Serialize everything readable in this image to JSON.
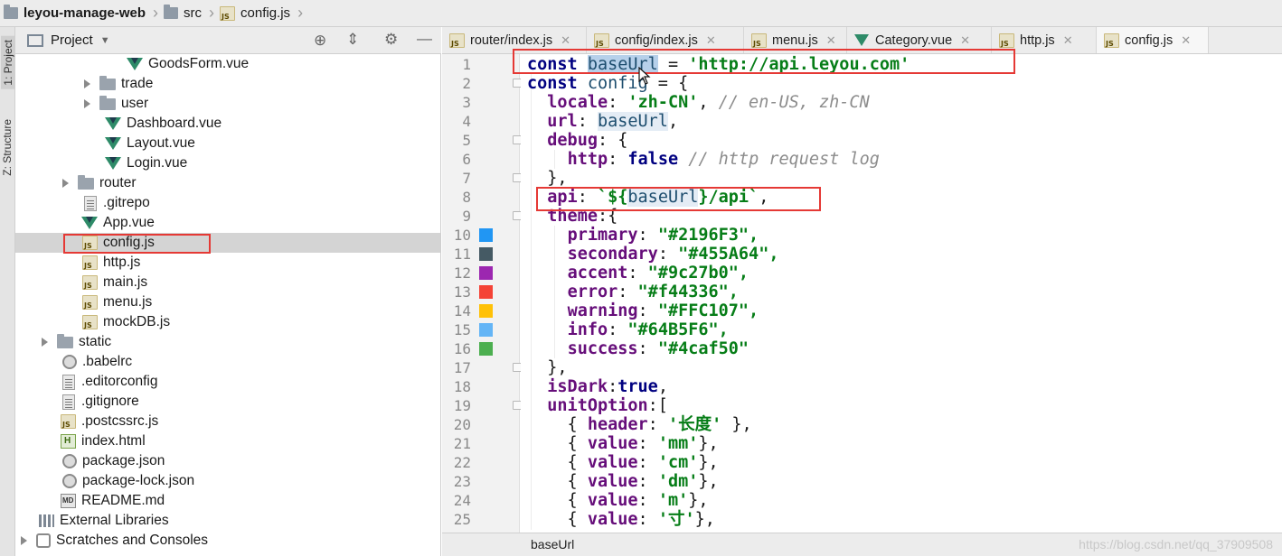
{
  "nav": {
    "project": "leyou-manage-web",
    "folder": "src",
    "file": "config.js"
  },
  "side_tabs": {
    "project": "1: Project",
    "structure": "Z: Structure"
  },
  "project_panel": {
    "title": "Project",
    "tree": [
      {
        "label": "GoodsForm.vue",
        "icon": "vue-file-icon",
        "level": 5
      },
      {
        "label": "trade",
        "icon": "folder-icon",
        "level": 4,
        "expandable": true
      },
      {
        "label": "user",
        "icon": "folder-icon",
        "level": 4,
        "expandable": true
      },
      {
        "label": "Dashboard.vue",
        "icon": "vue-file-icon",
        "level": 4
      },
      {
        "label": "Layout.vue",
        "icon": "vue-file-icon",
        "level": 4
      },
      {
        "label": "Login.vue",
        "icon": "vue-file-icon",
        "level": 4
      },
      {
        "label": "router",
        "icon": "folder-icon",
        "level": 3,
        "expandable": true
      },
      {
        "label": ".gitrepo",
        "icon": "text-file-icon",
        "level": 3
      },
      {
        "label": "App.vue",
        "icon": "vue-file-icon",
        "level": 3
      },
      {
        "label": "config.js",
        "icon": "js-file-icon",
        "level": 3,
        "selected": true
      },
      {
        "label": "http.js",
        "icon": "js-file-icon",
        "level": 3
      },
      {
        "label": "main.js",
        "icon": "js-file-icon",
        "level": 3
      },
      {
        "label": "menu.js",
        "icon": "js-file-icon",
        "level": 3
      },
      {
        "label": "mockDB.js",
        "icon": "js-file-icon",
        "level": 3
      },
      {
        "label": "static",
        "icon": "folder-icon",
        "level": 2,
        "expandable": true
      },
      {
        "label": ".babelrc",
        "icon": "config-file-icon",
        "level": 2
      },
      {
        "label": ".editorconfig",
        "icon": "text-file-icon",
        "level": 2
      },
      {
        "label": ".gitignore",
        "icon": "text-file-icon",
        "level": 2
      },
      {
        "label": ".postcssrc.js",
        "icon": "js-file-icon",
        "level": 2
      },
      {
        "label": "index.html",
        "icon": "html-file-icon",
        "level": 2
      },
      {
        "label": "package.json",
        "icon": "config-file-icon",
        "level": 2
      },
      {
        "label": "package-lock.json",
        "icon": "config-file-icon",
        "level": 2
      },
      {
        "label": "README.md",
        "icon": "markdown-file-icon",
        "level": 2
      },
      {
        "label": "External Libraries",
        "icon": "libraries-icon",
        "level": 1
      },
      {
        "label": "Scratches and Consoles",
        "icon": "scratches-icon",
        "level": 1,
        "expandable": true
      }
    ]
  },
  "editor_tabs": [
    {
      "label": "router/index.js",
      "icon": "js-file-icon"
    },
    {
      "label": "config/index.js",
      "icon": "js-file-icon"
    },
    {
      "label": "menu.js",
      "icon": "js-file-icon"
    },
    {
      "label": "Category.vue",
      "icon": "vue-file-icon"
    },
    {
      "label": "http.js",
      "icon": "js-file-icon"
    },
    {
      "label": "config.js",
      "icon": "js-file-icon",
      "active": true
    }
  ],
  "code_lines": [
    "1",
    "2",
    "3",
    "4",
    "5",
    "6",
    "7",
    "8",
    "9",
    "10",
    "11",
    "12",
    "13",
    "14",
    "15",
    "16",
    "17",
    "18",
    "19",
    "20",
    "21",
    "22",
    "23",
    "24",
    "25"
  ],
  "color_swatches": [
    "#2196F3",
    "#455A64",
    "#9c27b0",
    "#f44336",
    "#FFC107",
    "#64B5F6",
    "#4caf50"
  ],
  "code": {
    "l1": {
      "k": "const",
      "v": "baseUrl",
      "eq": " = ",
      "s": "'http://api.leyou.com'"
    },
    "l2": {
      "k": "const",
      "v": "config",
      "rest": " = {"
    },
    "l3": {
      "p": "locale",
      "s": "'zh-CN'",
      "c": "// en-US, zh-CN"
    },
    "l4": {
      "p": "url",
      "v": "baseUrl"
    },
    "l5": {
      "p": "debug"
    },
    "l6": {
      "p": "http",
      "k": "false",
      "c": "// http request log"
    },
    "l8": {
      "p": "api",
      "a": "`${",
      "v": "baseUrl",
      "b": "}/api`"
    },
    "l9": {
      "p": "theme"
    },
    "theme": [
      {
        "p": "primary",
        "s": "\"#2196F3\","
      },
      {
        "p": "secondary",
        "s": "\"#455A64\","
      },
      {
        "p": "accent",
        "s": "\"#9c27b0\","
      },
      {
        "p": "error",
        "s": "\"#f44336\","
      },
      {
        "p": "warning",
        "s": "\"#FFC107\","
      },
      {
        "p": "info",
        "s": "\"#64B5F6\","
      },
      {
        "p": "success",
        "s": "\"#4caf50\""
      }
    ],
    "l18": {
      "p": "isDark",
      "k": "true"
    },
    "l19": {
      "p": "unitOption"
    },
    "l20": {
      "p": "header",
      "s": "'长度'"
    },
    "units": [
      "'mm'",
      "'cm'",
      "'dm'",
      "'m'",
      "'寸'"
    ],
    "value_key": "value"
  },
  "status_bar": {
    "breadcrumb": "baseUrl",
    "watermark": "https://blog.csdn.net/qq_37909508"
  }
}
